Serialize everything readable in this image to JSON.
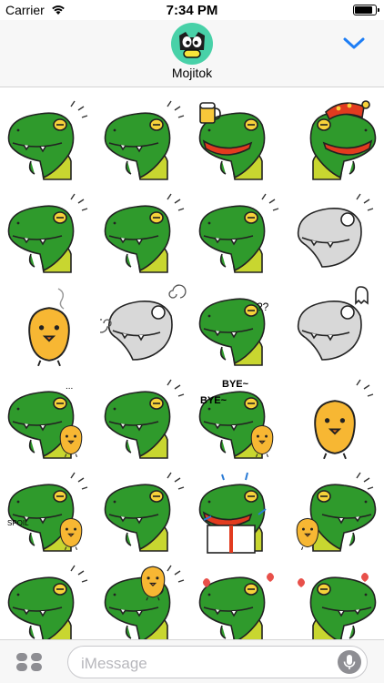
{
  "status_bar": {
    "carrier": "Carrier",
    "time": "7:34 PM",
    "battery_level": 0.9
  },
  "header": {
    "app_name": "Mojitok",
    "collapse_icon": "chevron-down-icon",
    "accent_color": "#1e7ef5"
  },
  "stickers": {
    "items": [
      {
        "pose": "thinking",
        "theme": "croc"
      },
      {
        "pose": "grumpy",
        "theme": "croc"
      },
      {
        "pose": "cheers-beer",
        "theme": "croc"
      },
      {
        "pose": "party-hat",
        "theme": "croc"
      },
      {
        "pose": "arms-crossed",
        "theme": "croc"
      },
      {
        "pose": "turned-away",
        "theme": "croc"
      },
      {
        "pose": "smirk",
        "theme": "croc"
      },
      {
        "pose": "blushing-ghost",
        "theme": "gray"
      },
      {
        "pose": "floating-chick",
        "theme": "chick"
      },
      {
        "pose": "stunned",
        "theme": "gray"
      },
      {
        "pose": "confused",
        "theme": "croc"
      },
      {
        "pose": "sad-ghost",
        "theme": "gray"
      },
      {
        "pose": "with-chick",
        "theme": "croc"
      },
      {
        "pose": "facepalm",
        "theme": "croc"
      },
      {
        "pose": "waving-bye",
        "theme": "croc"
      },
      {
        "pose": "grumpy-chick",
        "theme": "chick"
      },
      {
        "pose": "love-gift",
        "theme": "croc"
      },
      {
        "pose": "walking",
        "theme": "croc"
      },
      {
        "pose": "surprise-box",
        "theme": "croc"
      },
      {
        "pose": "chick-walk",
        "theme": "croc"
      },
      {
        "pose": "hug",
        "theme": "croc"
      },
      {
        "pose": "chick-on-head",
        "theme": "croc"
      },
      {
        "pose": "blush",
        "theme": "croc"
      },
      {
        "pose": "in-love",
        "theme": "croc"
      }
    ],
    "labels": {
      "bye_1": "BYE~",
      "bye_2": "BYE~",
      "confused": "??",
      "dots": "...",
      "gift": "SPOIL"
    }
  },
  "bottom_bar": {
    "apps_icon": "app-drawer-icon",
    "placeholder": "iMessage",
    "mic_icon": "microphone-icon"
  },
  "colors": {
    "croc_green": "#2f9a2c",
    "croc_belly": "#c8d630",
    "mouth_red": "#e23b1f",
    "chick_yellow": "#f7b733",
    "ghost_gray": "#d8d8d8"
  }
}
